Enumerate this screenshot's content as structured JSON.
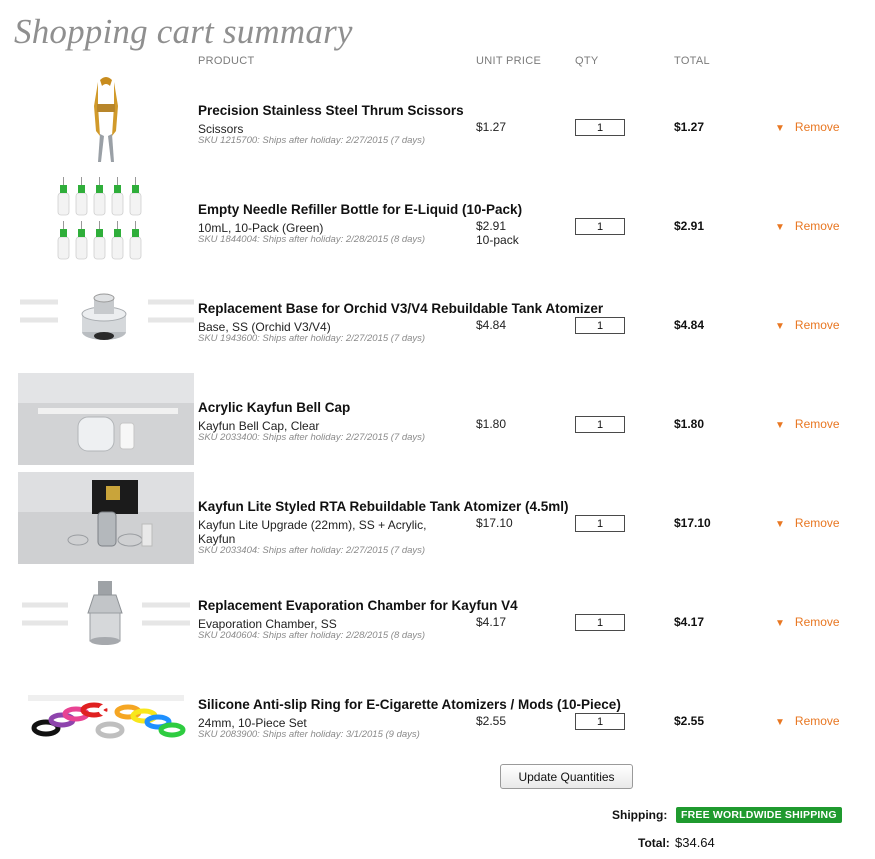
{
  "page": {
    "title": "Shopping cart summary"
  },
  "columns": {
    "product": "PRODUCT",
    "unit_price": "UNIT PRICE",
    "qty": "QTY",
    "total": "TOTAL"
  },
  "remove_label": "Remove",
  "items": [
    {
      "name": "Precision Stainless Steel Thrum Scissors",
      "variant": "Scissors",
      "sku": "SKU 1215700: Ships after holiday: 2/27/2015 (7 days)",
      "unit_price": "$1.27",
      "unit_note": "",
      "qty": "1",
      "total": "$1.27",
      "thumb_icon": "scissors-icon"
    },
    {
      "name": "Empty Needle Refiller Bottle for E-Liquid (10-Pack)",
      "variant": "10mL, 10-Pack (Green)",
      "sku": "SKU 1844004: Ships after holiday: 2/28/2015 (8 days)",
      "unit_price": "$2.91",
      "unit_note": "10-pack",
      "qty": "1",
      "total": "$2.91",
      "thumb_icon": "needle-bottles-icon"
    },
    {
      "name": "Replacement Base for Orchid V3/V4 Rebuildable Tank Atomizer",
      "variant": "Base, SS (Orchid V3/V4)",
      "sku": "SKU 1943600: Ships after holiday: 2/27/2015 (7 days)",
      "unit_price": "$4.84",
      "unit_note": "",
      "qty": "1",
      "total": "$4.84",
      "thumb_icon": "atomizer-base-icon"
    },
    {
      "name": "Acrylic Kayfun Bell Cap",
      "variant": "Kayfun Bell Cap, Clear",
      "sku": "SKU 2033400: Ships after holiday: 2/27/2015 (7 days)",
      "unit_price": "$1.80",
      "unit_note": "",
      "qty": "1",
      "total": "$1.80",
      "thumb_icon": "bell-cap-icon"
    },
    {
      "name": "Kayfun Lite Styled RTA Rebuildable Tank Atomizer (4.5ml)",
      "variant": "Kayfun Lite Upgrade (22mm), SS + Acrylic, Kayfun",
      "sku": "SKU 2033404: Ships after holiday: 2/27/2015 (7 days)",
      "unit_price": "$17.10",
      "unit_note": "",
      "qty": "1",
      "total": "$17.10",
      "thumb_icon": "rta-kit-icon"
    },
    {
      "name": "Replacement Evaporation Chamber for Kayfun V4",
      "variant": "Evaporation Chamber, SS",
      "sku": "SKU 2040604: Ships after holiday: 2/28/2015 (8 days)",
      "unit_price": "$4.17",
      "unit_note": "",
      "qty": "1",
      "total": "$4.17",
      "thumb_icon": "evaporation-chamber-icon"
    },
    {
      "name": "Silicone Anti-slip Ring for E-Cigarette Atomizers / Mods (10-Piece)",
      "variant": "24mm, 10-Piece Set",
      "sku": "SKU 2083900: Ships after holiday: 3/1/2015 (9 days)",
      "unit_price": "$2.55",
      "unit_note": "",
      "qty": "1",
      "total": "$2.55",
      "thumb_icon": "silicone-rings-icon"
    }
  ],
  "footer": {
    "update_label": "Update Quantities",
    "shipping_label": "Shipping:",
    "shipping_value": "FREE WORLDWIDE SHIPPING",
    "total_label": "Total:",
    "total_value": "$34.64"
  },
  "colors": {
    "accent": "#e87722",
    "shipping_badge": "#1f9a2e",
    "title": "#8f8f8f"
  }
}
